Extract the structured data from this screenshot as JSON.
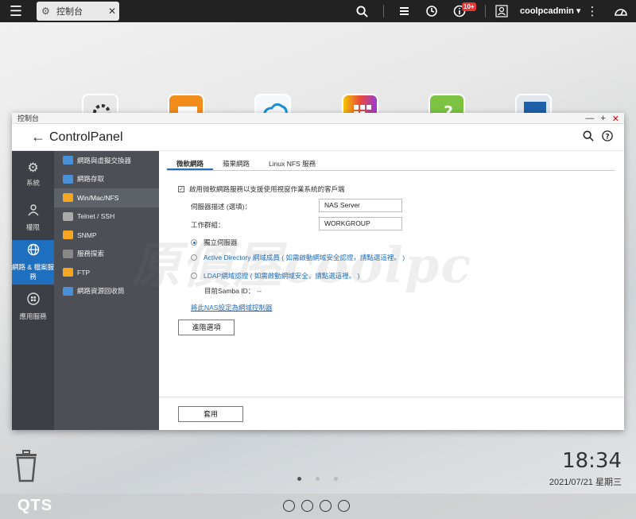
{
  "topbar": {
    "tab_label": "控制台",
    "badge": "10+",
    "username": "coolpcadmin ▾"
  },
  "window": {
    "title": "控制台",
    "app_title_bold": "Control",
    "app_title_rest": "Panel"
  },
  "nav": {
    "items": [
      {
        "label": "系統",
        "icon": "gear-icon"
      },
      {
        "label": "權限",
        "icon": "user-icon"
      },
      {
        "label": "網路 & 檔案服務",
        "icon": "globe-icon",
        "active": true
      },
      {
        "label": "應用服務",
        "icon": "apps-icon"
      }
    ]
  },
  "subnav": {
    "items": [
      {
        "label": "網路與虛擬交換器",
        "color": "#4a90d9"
      },
      {
        "label": "網路存取",
        "color": "#4a90d9"
      },
      {
        "label": "Win/Mac/NFS",
        "color": "#f5a623",
        "active": true
      },
      {
        "label": "Telnet / SSH",
        "color": "#aaaaaa"
      },
      {
        "label": "SNMP",
        "color": "#f5a623"
      },
      {
        "label": "服務探索",
        "color": "#888888"
      },
      {
        "label": "FTP",
        "color": "#f5a623"
      },
      {
        "label": "網路資源回收筒",
        "color": "#4a90d9"
      }
    ]
  },
  "tabs": [
    "微軟網路",
    "蘋果網路",
    "Linux NFS 服務"
  ],
  "form": {
    "enable_label": "啟用微軟網路服務以支援使用視窗作業系統的客戶端",
    "server_desc_label": "伺服器描述 (選填)：",
    "server_desc_value": "NAS Server",
    "workgroup_label": "工作群組：",
    "workgroup_value": "WORKGROUP",
    "standalone_label": "獨立伺服器",
    "ad_label": "Active Directory 網域成員 ( 如需啟動網域安全認證，請點選這裡。 )",
    "ldap_label": "LDAP網域認證 ( 如需啟動網域安全，請點選這裡。 )",
    "samba_label": "目前Samba ID：",
    "samba_value": "--",
    "dc_link": "將此NAS設定為網域控制器",
    "advanced_button": "進階選項",
    "apply_button": "套用"
  },
  "watermark": "原價屋coolpc",
  "desktop": {
    "time": "18:34",
    "date": "2021/07/21 星期三",
    "brand": "QTS"
  }
}
